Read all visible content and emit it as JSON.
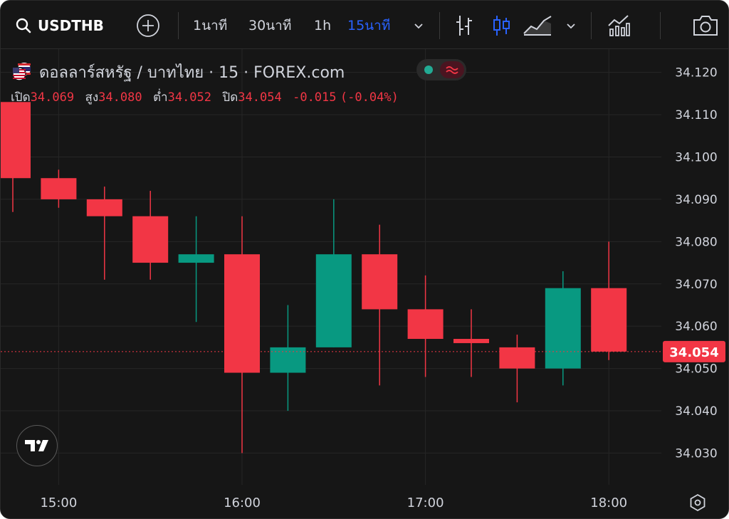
{
  "toolbar": {
    "symbol": "USDTHB",
    "intervals": [
      {
        "label": "1นาที",
        "active": false
      },
      {
        "label": "30นาที",
        "active": false
      },
      {
        "label": "1h",
        "active": false
      },
      {
        "label": "15นาที",
        "active": true
      }
    ],
    "icons": [
      "search-icon",
      "add-compare-icon",
      "chevron-down-icon",
      "bar-chart-style-icon",
      "candle-chart-style-icon",
      "area-chart-style-icon",
      "chevron-down-icon",
      "indicators-icon",
      "camera-icon"
    ]
  },
  "legend": {
    "title": "ดอลลาร์สหรัฐ / บาทไทย · 15 · FOREX.com",
    "ohlc": {
      "open_label": "เปิด",
      "open": "34.069",
      "high_label": "สูง",
      "high": "34.080",
      "low_label": "ต่ำ",
      "low": "34.052",
      "close_label": "ปิด",
      "close": "34.054",
      "change": "-0.015",
      "change_pct": "(-0.04%)"
    }
  },
  "colors": {
    "background": "#161616",
    "grid": "#262626",
    "up": "#089981",
    "down": "#f23645",
    "text": "#d1d4dc",
    "active": "#2962ff"
  },
  "chart_data": {
    "type": "candlestick",
    "symbol": "USDTHB",
    "timeframe": "15",
    "candles": [
      {
        "time": "14:45",
        "open": 34.113,
        "high": 34.113,
        "low": 34.087,
        "close": 34.095
      },
      {
        "time": "15:00",
        "open": 34.095,
        "high": 34.097,
        "low": 34.088,
        "close": 34.09
      },
      {
        "time": "15:15",
        "open": 34.09,
        "high": 34.093,
        "low": 34.071,
        "close": 34.086
      },
      {
        "time": "15:30",
        "open": 34.086,
        "high": 34.092,
        "low": 34.071,
        "close": 34.075
      },
      {
        "time": "15:45",
        "open": 34.075,
        "high": 34.086,
        "low": 34.061,
        "close": 34.077
      },
      {
        "time": "16:00",
        "open": 34.077,
        "high": 34.086,
        "low": 34.03,
        "close": 34.049
      },
      {
        "time": "16:15",
        "open": 34.049,
        "high": 34.065,
        "low": 34.04,
        "close": 34.055
      },
      {
        "time": "16:30",
        "open": 34.055,
        "high": 34.09,
        "low": 34.055,
        "close": 34.077
      },
      {
        "time": "16:45",
        "open": 34.077,
        "high": 34.084,
        "low": 34.046,
        "close": 34.064
      },
      {
        "time": "17:00",
        "open": 34.064,
        "high": 34.072,
        "low": 34.048,
        "close": 34.057
      },
      {
        "time": "17:15",
        "open": 34.057,
        "high": 34.064,
        "low": 34.048,
        "close": 34.056
      },
      {
        "time": "17:30",
        "open": 34.055,
        "high": 34.058,
        "low": 34.042,
        "close": 34.05
      },
      {
        "time": "17:45",
        "open": 34.05,
        "high": 34.073,
        "low": 34.046,
        "close": 34.069
      },
      {
        "time": "18:00",
        "open": 34.069,
        "high": 34.08,
        "low": 34.052,
        "close": 34.054
      }
    ],
    "y_ticks": [
      "34.120",
      "34.110",
      "34.100",
      "34.090",
      "34.080",
      "34.070",
      "34.060",
      "34.050",
      "34.040",
      "34.030"
    ],
    "x_ticks": [
      "15:00",
      "16:00",
      "17:00",
      "18:00"
    ],
    "last_price": "34.054",
    "ylim": [
      34.0225,
      34.1255
    ]
  }
}
